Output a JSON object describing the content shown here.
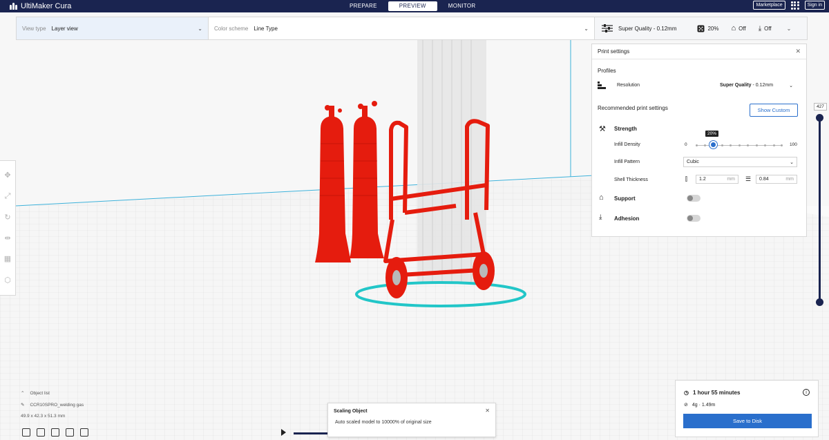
{
  "app": {
    "title": "UltiMaker Cura"
  },
  "stages": [
    {
      "label": "PREPARE"
    },
    {
      "label": "PREVIEW"
    },
    {
      "label": "MONITOR"
    }
  ],
  "topbar": {
    "marketplace": "Marketplace",
    "signin": "Sign in"
  },
  "header": {
    "view_type_label": "View type",
    "view_type_value": "Layer view",
    "color_scheme_label": "Color scheme",
    "color_scheme_value": "Line Type",
    "quality": "Super Quality - 0.12mm",
    "infill": "20%",
    "support": "Off",
    "adhesion": "Off"
  },
  "print_settings": {
    "title": "Print settings",
    "profiles": "Profiles",
    "resolution_label": "Resolution",
    "resolution_bold": "Super Quality",
    "resolution_rest": " - 0.12mm",
    "recommended": "Recommended print settings",
    "show_custom": "Show Custom",
    "strength": "Strength",
    "infill_density": "Infill Density",
    "infill_min": "0",
    "infill_max": "100",
    "infill_value": "20%",
    "infill_fraction": 0.2,
    "infill_pattern_label": "Infill Pattern",
    "infill_pattern": "Cubic",
    "shell_thickness_label": "Shell Thickness",
    "wall_value": "1.2",
    "top_bottom_value": "0.84",
    "unit": "mm",
    "support": "Support",
    "adhesion": "Adhesion"
  },
  "layer": {
    "current": "427"
  },
  "object_list": {
    "label": "Object list",
    "name": "CCR10SPRO_welding gas",
    "dimensions": "49.9 x 42.3 x 51.3 mm"
  },
  "notification": {
    "title": "Scaling Object",
    "message": "Auto scaled model to 10000% of original size"
  },
  "estimate": {
    "time": "1 hour 55 minutes",
    "material": "4g · 1.49m",
    "save": "Save to Disk"
  },
  "colors": {
    "brand": "#1a2450",
    "accent": "#2a6fcc",
    "model": "#e51c0e",
    "travel": "#22c6c8"
  }
}
